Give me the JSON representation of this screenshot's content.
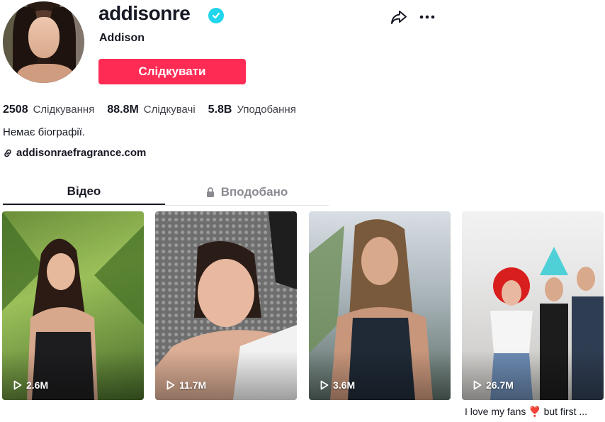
{
  "profile": {
    "username": "addisonre",
    "nickname": "Addison",
    "follow_label": "Слідкувати",
    "bio": "Немає біографії.",
    "link": "addisonraefragrance.com"
  },
  "stats": [
    {
      "value": "2508",
      "label": "Слідкування"
    },
    {
      "value": "88.8M",
      "label": "Слідкувачі"
    },
    {
      "value": "5.8B",
      "label": "Уподобання"
    }
  ],
  "tabs": {
    "videos": "Відео",
    "liked": "Вподобано"
  },
  "videos": [
    {
      "views": "2.6M"
    },
    {
      "views": "11.7M"
    },
    {
      "views": "3.6M"
    },
    {
      "views": "26.7M",
      "caption": "I love my fans ❣️ but first ..."
    }
  ],
  "colors": {
    "accent": "#fe2c55",
    "verified": "#20d5ec",
    "text": "#161823"
  },
  "icons": [
    "verified-badge-icon",
    "share-icon",
    "more-icon",
    "link-icon",
    "lock-icon",
    "play-icon"
  ]
}
